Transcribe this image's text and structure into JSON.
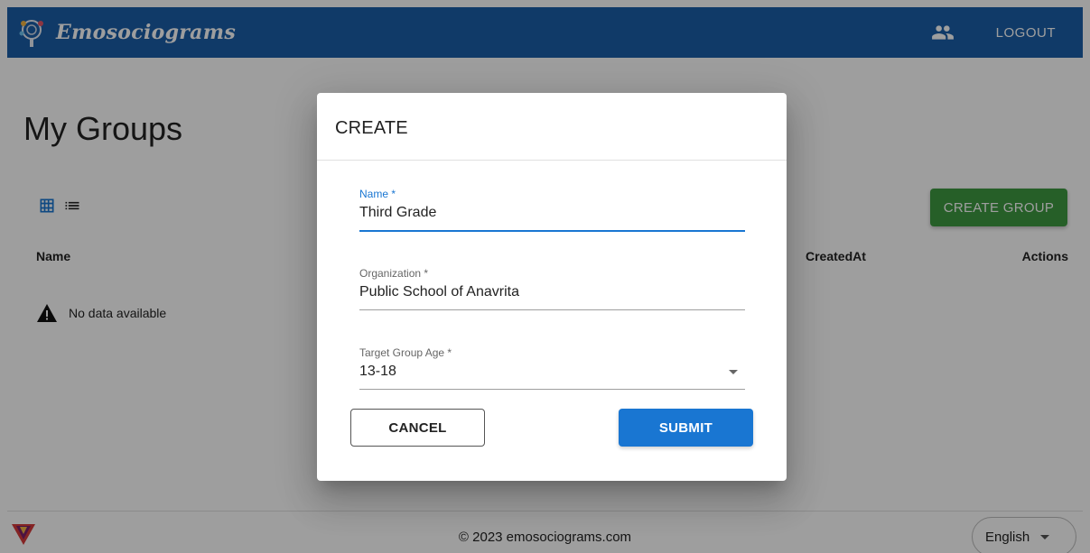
{
  "app": {
    "brand_name": "Emosociograms"
  },
  "header": {
    "people_icon": "people-icon",
    "logout_label": "LOGOUT"
  },
  "page": {
    "title": "My Groups",
    "view_toggles": [
      "grid-view-icon",
      "list-view-icon"
    ],
    "create_group_label": "CREATE GROUP",
    "table": {
      "columns": [
        "Name",
        "CreatedAt",
        "Actions"
      ],
      "empty_text": "No data available"
    }
  },
  "footer": {
    "copyright": "© 2023 emosociograms.com",
    "language": "English"
  },
  "dialog": {
    "title": "CREATE",
    "fields": {
      "name": {
        "label": "Name *",
        "value": "Third Grade"
      },
      "organization": {
        "label": "Organization *",
        "value": "Public School of Anavrita"
      },
      "target_age": {
        "label": "Target Group Age *",
        "value": "13-18"
      }
    },
    "cancel_label": "CANCEL",
    "submit_label": "SUBMIT"
  },
  "colors": {
    "appbar": "#1b5ea8",
    "primary": "#1976d2",
    "create_button": "#3e9a42"
  }
}
